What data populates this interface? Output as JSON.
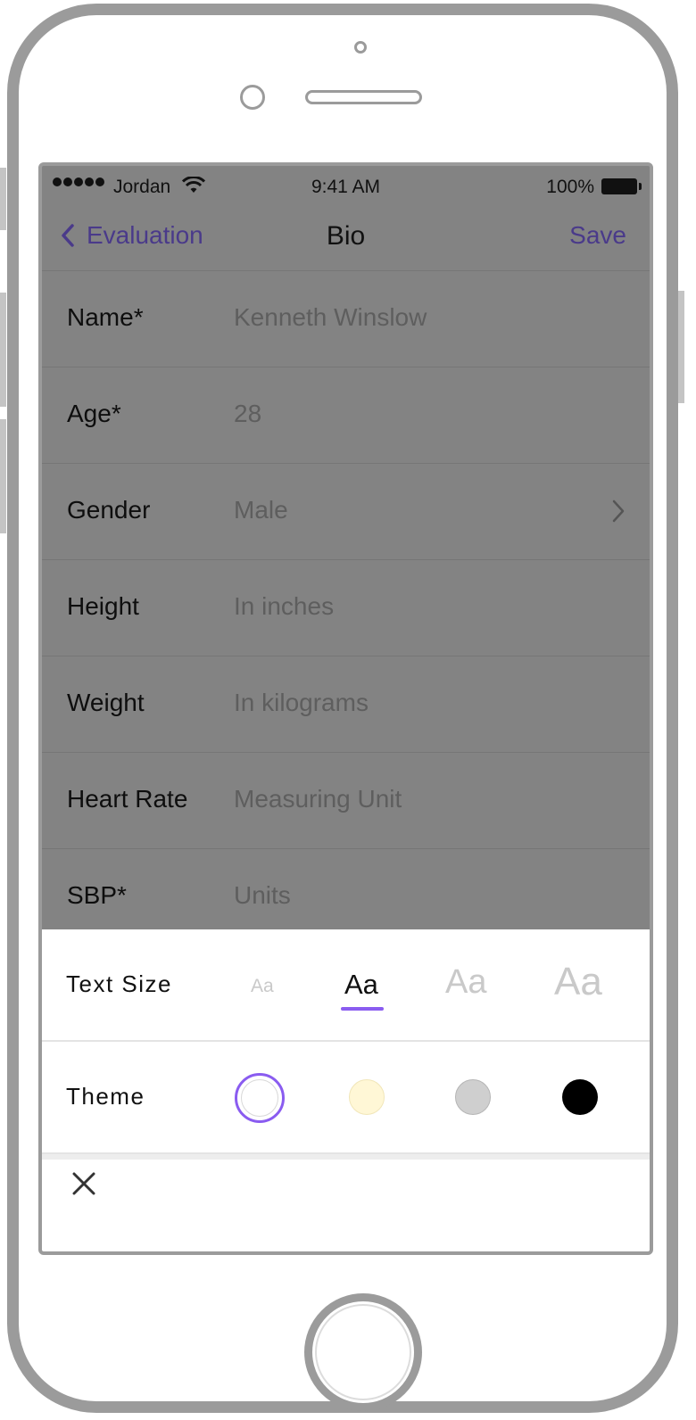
{
  "status_bar": {
    "carrier": "Jordan",
    "time": "9:41 AM",
    "battery": "100%"
  },
  "nav": {
    "back_label": "Evaluation",
    "title": "Bio",
    "save_label": "Save"
  },
  "form": {
    "rows": [
      {
        "label": "Name*",
        "value": "Kenneth Winslow"
      },
      {
        "label": "Age*",
        "value": "28"
      },
      {
        "label": "Gender",
        "value": "Male"
      },
      {
        "label": "Height",
        "value": "In inches"
      },
      {
        "label": "Weight",
        "value": "In kilograms"
      },
      {
        "label": "Heart Rate",
        "value": "Measuring Unit"
      },
      {
        "label": "SBP*",
        "value": "Units"
      }
    ]
  },
  "sheet": {
    "text_size_label": "Text Size",
    "text_size_options": [
      "Aa",
      "Aa",
      "Aa",
      "Aa"
    ],
    "selected_text_size": 2,
    "theme_label": "Theme",
    "themes": [
      {
        "name": "white",
        "color": "#ffffff"
      },
      {
        "name": "sepia",
        "color": "#fff7d6"
      },
      {
        "name": "gray",
        "color": "#cfcfcf"
      },
      {
        "name": "black",
        "color": "#000000"
      }
    ],
    "selected_theme": "white"
  },
  "colors": {
    "accent": "#8a5cf0",
    "nav_tint": "#4a3a8a",
    "overlay": "#838383"
  },
  "icons": {
    "back": "chevron-left-icon",
    "disclosure": "chevron-right-icon",
    "close": "close-icon",
    "wifi": "wifi-icon",
    "battery": "battery-icon"
  }
}
